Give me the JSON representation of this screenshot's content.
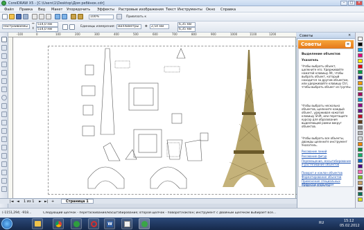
{
  "window": {
    "title": "CorelDRAW X5 - [C:\\Users\\1\\Desktop\\Дом ребёнок.cdr]",
    "controls": [
      "–",
      "□",
      "×"
    ]
  },
  "menu": [
    "Файл",
    "Правка",
    "Вид",
    "Макет",
    "Упорядочить",
    "Эффекты",
    "Растровые изображения",
    "Текст",
    "Инструменты",
    "Окно",
    "Справка"
  ],
  "toolbar": {
    "zoom_value": "100%",
    "snap_label": "Привязать к"
  },
  "property_bar": {
    "preset": "Настраиваемы",
    "width": "514,0 мм",
    "height": "514,0 мм",
    "units_label": "Единицы измерения:",
    "units_value": "миллиметры",
    "nudge": "2,54 мм",
    "dup_x": "6,35 мм",
    "dup_y": "6,35 мм"
  },
  "ruler": {
    "h_ticks": [
      "-100",
      "0",
      "100",
      "200",
      "300",
      "400",
      "500",
      "600",
      "700",
      "800",
      "900",
      "1000",
      "1100",
      "1200"
    ]
  },
  "docker": {
    "tab_title": "Советы",
    "header": "Советы",
    "section_title": "Выделение объектов",
    "tool_label": "Указатель",
    "bullets": [
      "Чтобы выбрать объект, щелкните его. Удерживайте нажатой клавишу Alt, чтобы выбрать объект, который находится за другим объектом, или удерживайте клавишу Ctrl, чтобы выбрать объект из группы.",
      "Чтобы выбрать несколько объектов, щелкните каждый объект, удерживая нажатой клавишу Shift, или перетащите курсор для образования выделяющей рамки вокруг объектов.",
      "Чтобы выбрать все объекты, дважды щелкните инструмент Указатель."
    ],
    "links": [
      "Рисование линий",
      "Рисование фигур",
      "Перемещение, масштабирование и растягивание объектов",
      "Поворот и наклон объектов",
      "Форматирование объектов",
      "Применение специальных эффектов к объектам",
      "Создание объектов"
    ]
  },
  "palette_colors": [
    "#ffffff",
    "#000000",
    "#00a0e9",
    "#e4007f",
    "#fff100",
    "#e60012",
    "#009944",
    "#1d2088",
    "#f39800",
    "#8fc31f",
    "#a40b5d",
    "#00a0c1",
    "#920783",
    "#601986",
    "#c30d23",
    "#5f3d1a",
    "#888888",
    "#b5b5b6",
    "#d7d7d7",
    "#f08300",
    "#00913a",
    "#13ae67",
    "#0068b7",
    "#4b0082",
    "#ff69b4",
    "#7fbe26",
    "#c9a063",
    "#40210f",
    "#006e54",
    "#d9e021"
  ],
  "doc_tabs": {
    "page_count": "1 из 1",
    "page_tab": "Страница 1"
  },
  "status": {
    "coords": "(-1151,294; -918...",
    "hint": "Следующий щелчок - перетаскивание/масштабирование; второй щелчок - поворот/наклон; инструмент с двойным щелчком выбирает все..."
  },
  "taskbar": {
    "apps": [
      "explorer",
      "chrome",
      "media",
      "opera",
      "word",
      "paint",
      "coreldraw"
    ],
    "lang": "RU",
    "time": "15:12",
    "date": "05.02.2012"
  },
  "colors": {
    "accent": "#e4781b",
    "tower": "#6b5a2a",
    "taskbar": "#1f3560"
  }
}
